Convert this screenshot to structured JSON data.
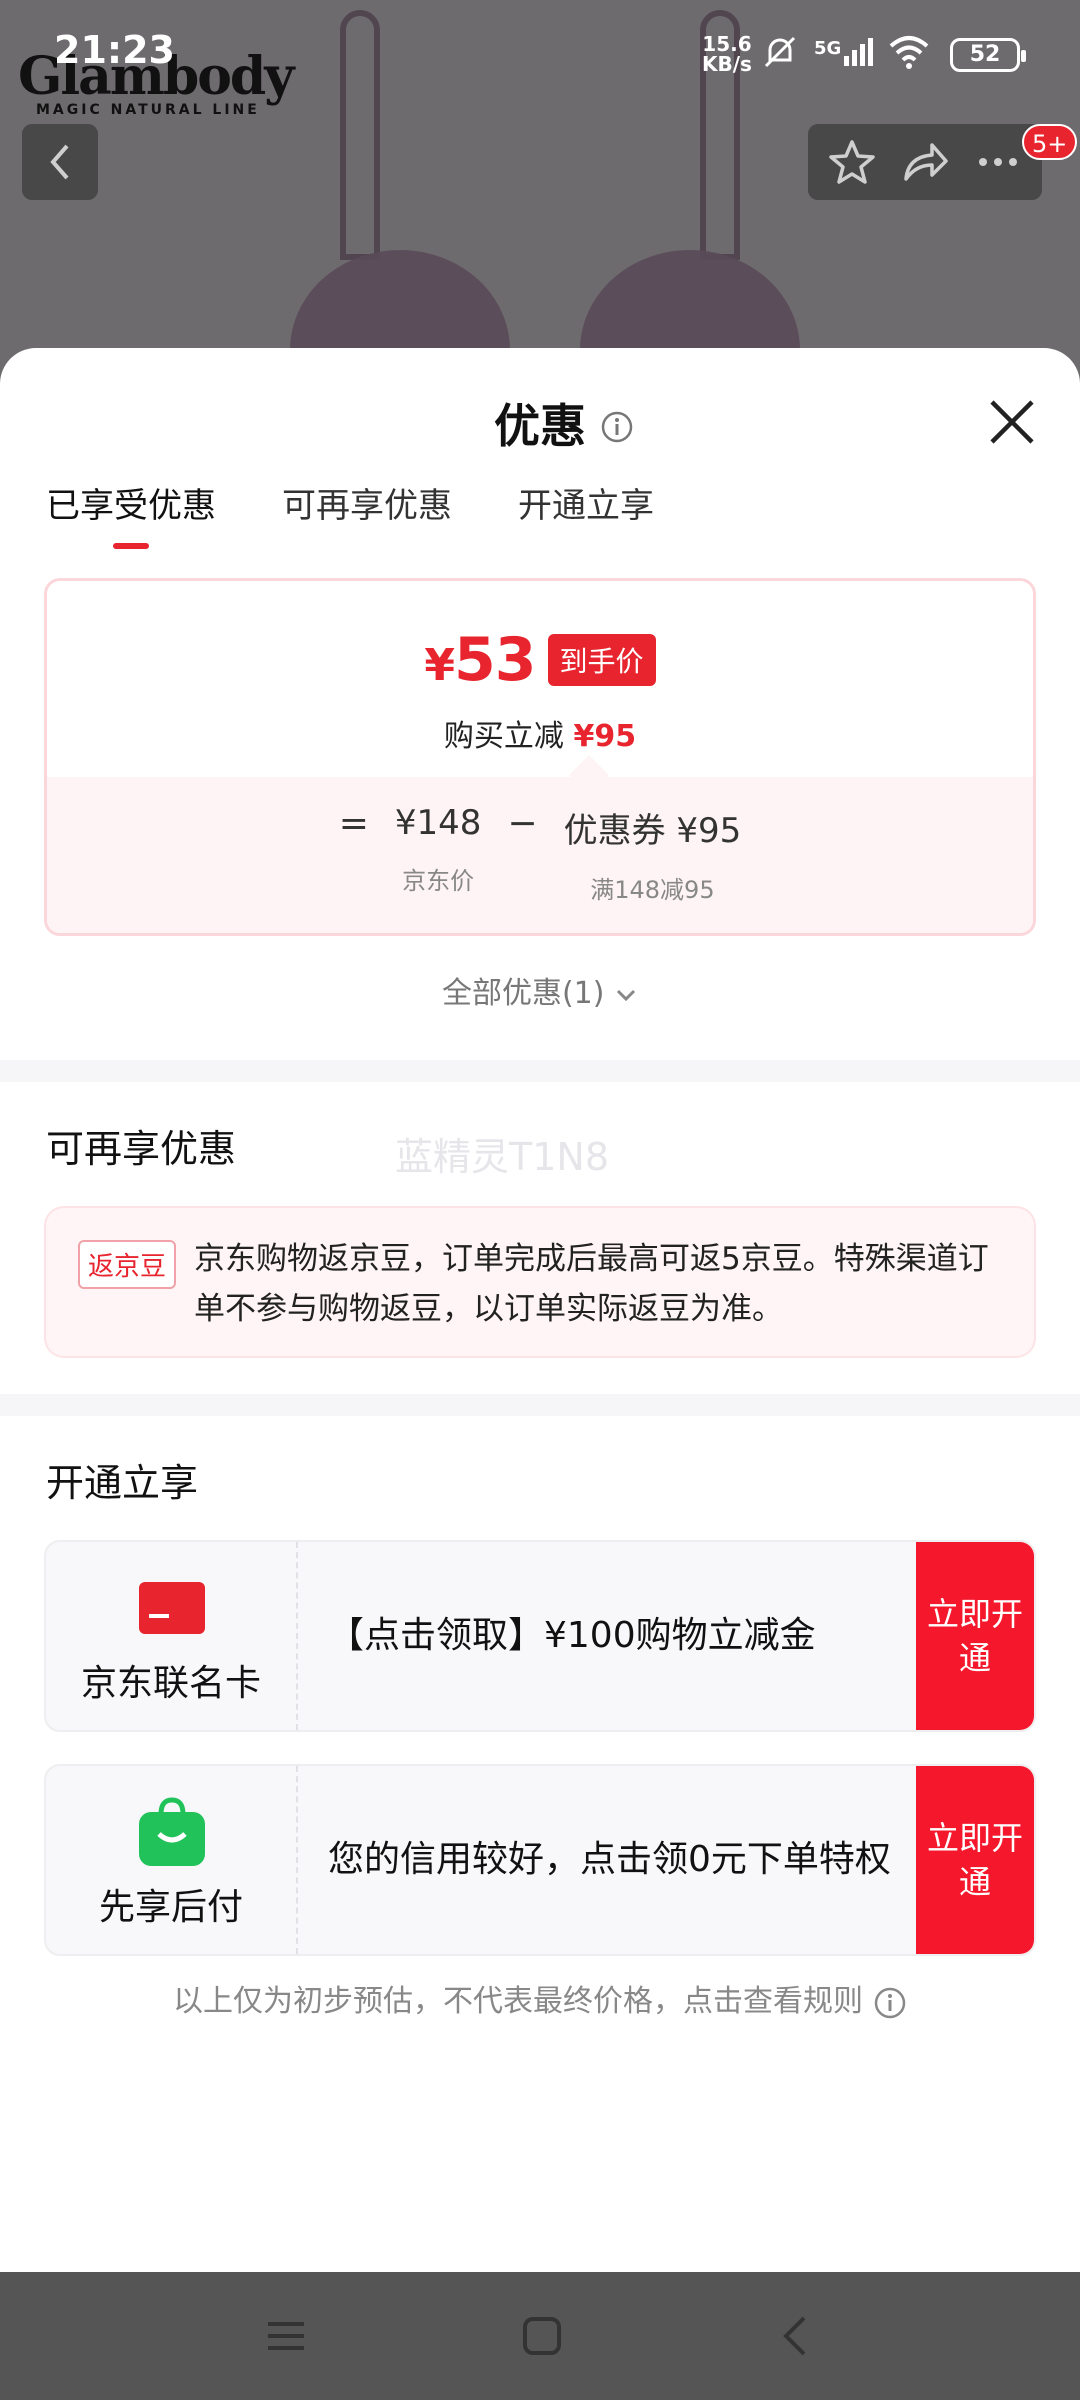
{
  "status_bar": {
    "time": "21:23",
    "net_speed_value": "15.6",
    "net_speed_unit": "KB/s",
    "network": "5G",
    "battery": "52"
  },
  "brand": {
    "name": "Glambody",
    "tagline": "MAGIC NATURAL LINE"
  },
  "top_nav": {
    "badge": "5+"
  },
  "sheet": {
    "title": "优惠",
    "tabs": [
      {
        "label": "已享受优惠",
        "active": true
      },
      {
        "label": "可再享优惠",
        "active": false
      },
      {
        "label": "开通立享",
        "active": false
      }
    ],
    "price_card": {
      "currency": "¥",
      "final_price": "53",
      "price_tag": "到手价",
      "instant_label": "购买立减",
      "instant_amount": "¥95",
      "equals": "=",
      "base_price": "¥148",
      "base_label": "京东价",
      "minus": "−",
      "coupon_price": "优惠券 ¥95",
      "coupon_label": "满148减95"
    },
    "all_offers": "全部优惠(1)",
    "section_more": {
      "title": "可再享优惠",
      "watermark": "蓝精灵T1N8",
      "tag": "返京豆",
      "text": "京东购物返京豆，订单完成后最高可返5京豆。特殊渠道订单不参与购物返豆，以订单实际返豆为准。"
    },
    "section_open": {
      "title": "开通立享",
      "cards": [
        {
          "name": "京东联名卡",
          "desc": "【点击领取】¥100购物立减金",
          "cta": "立即开通"
        },
        {
          "name": "先享后付",
          "desc": "您的信用较好，点击领0元下单特权",
          "cta": "立即开通"
        }
      ]
    },
    "footnote": "以上仅为初步预估，不代表最终价格，点击查看规则"
  },
  "colors": {
    "accent_red": "#e8242e",
    "cta_red": "#f5182c",
    "card_pink": "#fff4f5",
    "green": "#21c25a"
  }
}
